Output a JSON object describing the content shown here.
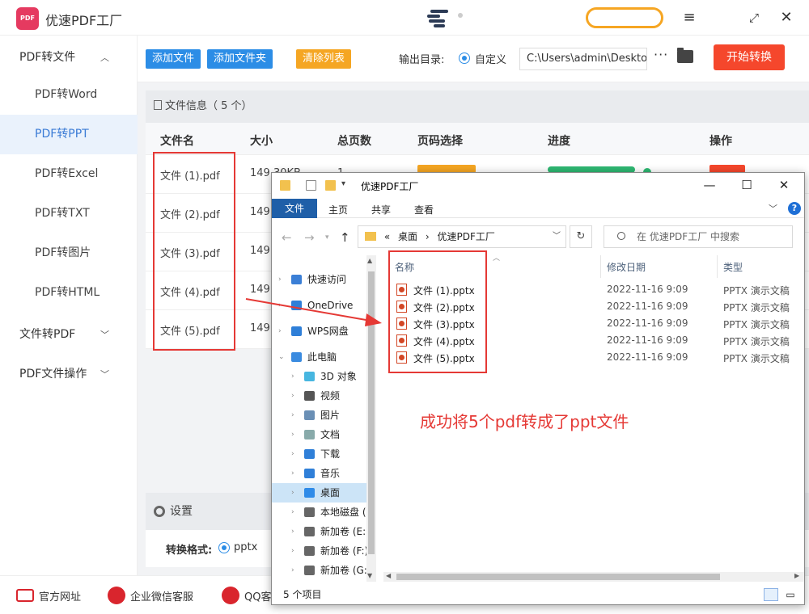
{
  "app": {
    "title": "优速PDF工厂",
    "logo_text": "PDF",
    "window_controls": [
      "menu-icon",
      "maximize-icon",
      "close-icon"
    ]
  },
  "sidebar": {
    "groups": [
      {
        "label": "PDF转文件",
        "expanded": true
      },
      {
        "label": "文件转PDF",
        "expanded": false
      },
      {
        "label": "PDF文件操作",
        "expanded": false
      }
    ],
    "items": [
      {
        "label": "PDF转Word",
        "active": false
      },
      {
        "label": "PDF转PPT",
        "active": true
      },
      {
        "label": "PDF转Excel",
        "active": false
      },
      {
        "label": "PDF转TXT",
        "active": false
      },
      {
        "label": "PDF转图片",
        "active": false
      },
      {
        "label": "PDF转HTML",
        "active": false
      }
    ]
  },
  "toolbar": {
    "add_file": "添加文件",
    "add_folder": "添加文件夹",
    "clear_list": "清除列表",
    "output_label": "输出目录:",
    "custom_option": "自定义",
    "output_path": "C:\\Users\\admin\\Desktop",
    "more": "···",
    "start": "开始转换"
  },
  "file_info": {
    "label": "文件信息（ 5 个）"
  },
  "table": {
    "headers": [
      "文件名",
      "大小",
      "总页数",
      "页码选择",
      "进度",
      "操作"
    ],
    "rows": [
      {
        "name": "文件 (1).pdf",
        "size": "149.30KB",
        "pages": "1"
      },
      {
        "name": "文件 (2).pdf",
        "size": "149.",
        "pages": ""
      },
      {
        "name": "文件 (3).pdf",
        "size": "149.",
        "pages": ""
      },
      {
        "name": "文件 (4).pdf",
        "size": "149.",
        "pages": ""
      },
      {
        "name": "文件 (5).pdf",
        "size": "149.",
        "pages": ""
      }
    ]
  },
  "settings": {
    "label": "设置",
    "format_label": "转换格式:",
    "format_value": "pptx"
  },
  "footer": {
    "links": [
      "官方网址",
      "企业微信客服",
      "QQ客"
    ]
  },
  "explorer": {
    "title": "优速PDF工厂",
    "ribbon_tabs": [
      "文件",
      "主页",
      "共享",
      "查看"
    ],
    "help": "?",
    "address": {
      "prefix": "«",
      "parts": [
        "桌面",
        "优速PDF工厂"
      ],
      "separator": "›"
    },
    "search_placeholder": "在 优速PDF工厂 中搜索",
    "nav_items": [
      {
        "label": "快速访问",
        "icon": "star-icon",
        "indent": 0
      },
      {
        "label": "OneDrive",
        "icon": "cloud-icon",
        "indent": 0
      },
      {
        "label": "WPS网盘",
        "icon": "cloud-icon",
        "indent": 0
      },
      {
        "label": "此电脑",
        "icon": "computer-icon",
        "indent": 0
      },
      {
        "label": "3D 对象",
        "icon": "cube-icon",
        "indent": 1
      },
      {
        "label": "视频",
        "icon": "video-icon",
        "indent": 1
      },
      {
        "label": "图片",
        "icon": "picture-icon",
        "indent": 1
      },
      {
        "label": "文档",
        "icon": "document-icon",
        "indent": 1
      },
      {
        "label": "下载",
        "icon": "download-icon",
        "indent": 1
      },
      {
        "label": "音乐",
        "icon": "music-icon",
        "indent": 1
      },
      {
        "label": "桌面",
        "icon": "desktop-icon",
        "indent": 1,
        "selected": true
      },
      {
        "label": "本地磁盘 (C",
        "icon": "drive-icon",
        "indent": 1
      },
      {
        "label": "新加卷 (E:)",
        "icon": "drive-icon",
        "indent": 1
      },
      {
        "label": "新加卷 (F:)",
        "icon": "drive-icon",
        "indent": 1
      },
      {
        "label": "新加卷 (G:)",
        "icon": "drive-icon",
        "indent": 1
      }
    ],
    "columns": [
      "名称",
      "修改日期",
      "类型"
    ],
    "files": [
      {
        "name": "文件 (1).pptx",
        "date": "2022-11-16 9:09",
        "type": "PPTX 演示文稿"
      },
      {
        "name": "文件 (2).pptx",
        "date": "2022-11-16 9:09",
        "type": "PPTX 演示文稿"
      },
      {
        "name": "文件 (3).pptx",
        "date": "2022-11-16 9:09",
        "type": "PPTX 演示文稿"
      },
      {
        "name": "文件 (4).pptx",
        "date": "2022-11-16 9:09",
        "type": "PPTX 演示文稿"
      },
      {
        "name": "文件 (5).pptx",
        "date": "2022-11-16 9:09",
        "type": "PPTX 演示文稿"
      }
    ],
    "status": "5 个项目"
  },
  "annotation": {
    "text": "成功将5个pdf转成了ppt文件",
    "color": "#e53935"
  },
  "colors": {
    "accent_blue": "#2c8de6",
    "accent_orange": "#f5a623",
    "start_red": "#f5472c",
    "sidebar_active": "#3a7bd5"
  }
}
